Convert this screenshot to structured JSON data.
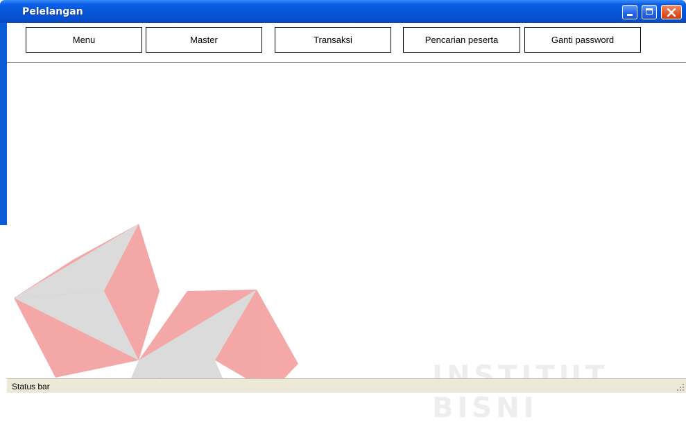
{
  "window": {
    "title": "Pelelangan",
    "controls": [
      "minimize-icon",
      "maximize-icon",
      "close-icon"
    ]
  },
  "toolbar": {
    "buttons": [
      {
        "label": "Menu"
      },
      {
        "label": "Master"
      },
      {
        "label": "Transaksi"
      },
      {
        "label": "Pencarian peserta"
      },
      {
        "label": "Ganti password"
      }
    ]
  },
  "statusbar": {
    "text": "Status bar"
  },
  "watermark": {
    "text": "INSTITUT BISNI"
  },
  "colors": {
    "titlebar": "#0756d8",
    "logo_red": "#f4a3a3",
    "logo_grey": "#d9d9d9",
    "statusbar": "#ece9d8"
  }
}
